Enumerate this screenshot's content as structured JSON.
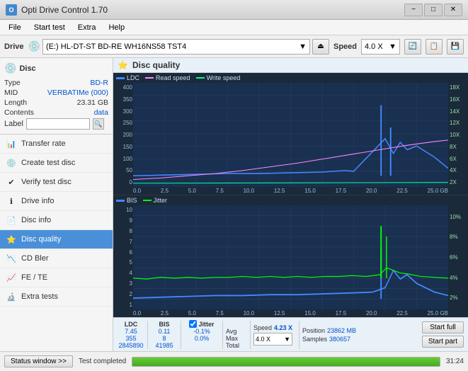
{
  "titlebar": {
    "icon": "O",
    "title": "Opti Drive Control 1.70",
    "min": "−",
    "max": "□",
    "close": "✕"
  },
  "menubar": {
    "items": [
      "File",
      "Start test",
      "Extra",
      "Help"
    ]
  },
  "drivebar": {
    "label": "Drive",
    "drive_icon": "💿",
    "drive_value": "(E:)  HL-DT-ST BD-RE  WH16NS58 TST4",
    "eject_icon": "⏏",
    "speed_label": "Speed",
    "speed_value": "4.0 X",
    "btn1": "🔄",
    "btn2": "📋",
    "btn3": "💾"
  },
  "disc": {
    "header": "Disc",
    "icon": "💿",
    "type_label": "Type",
    "type_val": "BD-R",
    "mid_label": "MID",
    "mid_val": "VERBATIMe (000)",
    "length_label": "Length",
    "length_val": "23.31 GB",
    "contents_label": "Contents",
    "contents_val": "data",
    "label_label": "Label",
    "label_val": ""
  },
  "nav": {
    "items": [
      {
        "id": "transfer-rate",
        "label": "Transfer rate",
        "icon": "📊"
      },
      {
        "id": "create-test-disc",
        "label": "Create test disc",
        "icon": "💿"
      },
      {
        "id": "verify-test-disc",
        "label": "Verify test disc",
        "icon": "✔"
      },
      {
        "id": "drive-info",
        "label": "Drive info",
        "icon": "ℹ"
      },
      {
        "id": "disc-info",
        "label": "Disc info",
        "icon": "📄"
      },
      {
        "id": "disc-quality",
        "label": "Disc quality",
        "icon": "⭐",
        "active": true
      },
      {
        "id": "cd-bler",
        "label": "CD Bler",
        "icon": "📉"
      },
      {
        "id": "fe-te",
        "label": "FE / TE",
        "icon": "📈"
      },
      {
        "id": "extra-tests",
        "label": "Extra tests",
        "icon": "🔬"
      }
    ]
  },
  "chart": {
    "title": "Disc quality",
    "icon": "⭐",
    "legend": {
      "ldc_label": "LDC",
      "ldc_color": "#4488ff",
      "read_label": "Read speed",
      "read_color": "#ff88ff",
      "write_label": "Write speed",
      "write_color": "#00ff88"
    },
    "legend2": {
      "bis_label": "BIS",
      "bis_color": "#4488ff",
      "jitter_label": "Jitter",
      "jitter_color": "#00ff00"
    },
    "y_axis1": [
      "400",
      "350",
      "300",
      "250",
      "200",
      "150",
      "100",
      "50",
      "0"
    ],
    "y_axis1_right": [
      "18X",
      "16X",
      "14X",
      "12X",
      "10X",
      "8X",
      "6X",
      "4X",
      "2X"
    ],
    "y_axis2": [
      "10",
      "9",
      "8",
      "7",
      "6",
      "5",
      "4",
      "3",
      "2",
      "1"
    ],
    "y_axis2_right": [
      "10%",
      "8%",
      "6%",
      "4%",
      "2%"
    ],
    "x_axis": [
      "0.0",
      "2.5",
      "5.0",
      "7.5",
      "10.0",
      "12.5",
      "15.0",
      "17.5",
      "20.0",
      "22.5",
      "25.0 GB"
    ]
  },
  "stats": {
    "ldc_header": "LDC",
    "bis_header": "BIS",
    "jitter_header": "Jitter",
    "speed_header": "Speed",
    "avg_label": "Avg",
    "max_label": "Max",
    "total_label": "Total",
    "ldc_avg": "7.45",
    "ldc_max": "355",
    "ldc_total": "2845890",
    "bis_avg": "0.11",
    "bis_max": "8",
    "bis_total": "41985",
    "jitter_avg": "-0.1%",
    "jitter_max": "0.0%",
    "jitter_total": "",
    "jitter_checked": true,
    "speed_val": "4.23 X",
    "speed_select": "4.0 X",
    "position_label": "Position",
    "position_val": "23862 MB",
    "samples_label": "Samples",
    "samples_val": "380657",
    "btn_start_full": "Start full",
    "btn_start_part": "Start part"
  },
  "statusbar": {
    "window_btn": "Status window >>",
    "progress": 100,
    "status_text": "Test completed",
    "time": "31:24"
  }
}
